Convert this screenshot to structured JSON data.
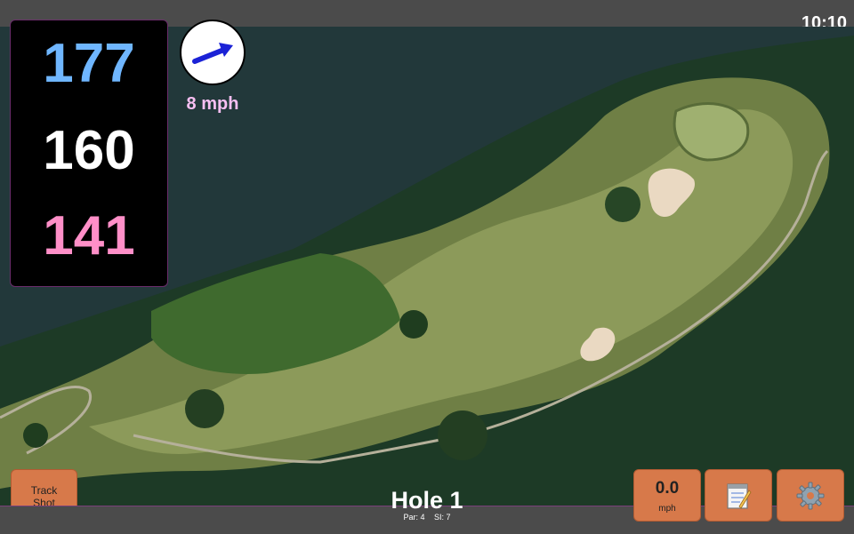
{
  "clock": "10:10",
  "distances": {
    "back": "177",
    "middle": "160",
    "front": "141"
  },
  "wind": {
    "speed_label": "8 mph",
    "icon": "wind-direction-arrow-icon"
  },
  "hole": {
    "title": "Hole 1",
    "par_label": "Par: 4",
    "si_label": "SI: 7"
  },
  "buttons": {
    "track_shot_line1": "Track",
    "track_shot_line2": "Shot",
    "speed_value": "0.0",
    "speed_unit": "mph",
    "notes_icon": "notepad-icon",
    "settings_icon": "gear-icon"
  },
  "colors": {
    "back": "#6fb6ff",
    "middle": "#ffffff",
    "front": "#ff8fc8",
    "button": "#d7794a",
    "wind_label": "#f7bff2"
  }
}
